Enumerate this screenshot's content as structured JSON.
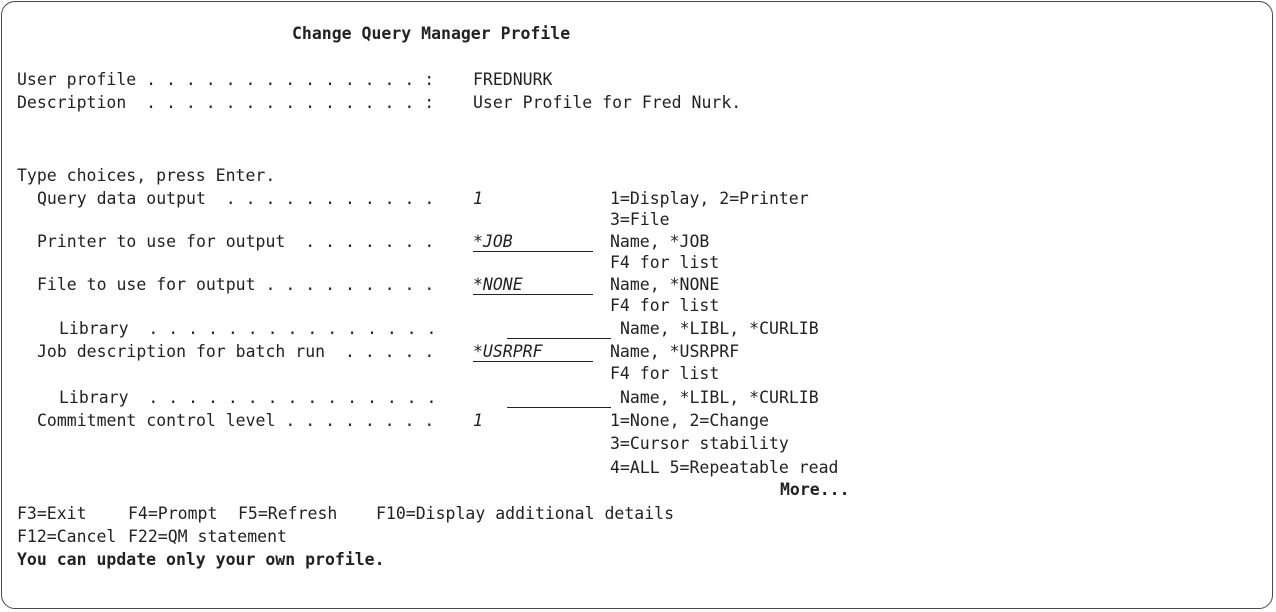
{
  "title": "Change Query Manager Profile",
  "header": {
    "user_profile_label": "User profile . . . . . . . . . . . . . . :",
    "user_profile_value": "FREDNURK",
    "description_label": "Description  . . . . . . . . . . . . . . :",
    "description_value": "User Profile for Fred Nurk."
  },
  "instruction": "Type choices, press Enter.",
  "fields": [
    {
      "label": "Query data output  . . . . . . . . . . .",
      "value": "1",
      "hint1": "1=Display, 2=Printer",
      "hint2": "3=File"
    },
    {
      "label": "Printer to use for output  . . . . . . .",
      "value": "*JOB",
      "hint1": "Name, *JOB",
      "hint2": "F4 for list"
    },
    {
      "label": "File to use for output . . . . . . . . .",
      "value": "*NONE",
      "hint1": "Name, *NONE",
      "hint2": "F4 for list"
    },
    {
      "label": "Library  . . . . . . . . . . . . . . .",
      "value": "",
      "hint1": "Name, *LIBL, *CURLIB"
    },
    {
      "label": "Job description for batch run  . . . . .",
      "value": "*USRPRF",
      "hint1": "Name, *USRPRF",
      "hint2": "F4 for list"
    },
    {
      "label": "Library  . . . . . . . . . . . . . . .",
      "value": "",
      "hint1": "Name, *LIBL, *CURLIB"
    },
    {
      "label": "Commitment control level . . . . . . . .",
      "value": "1",
      "hint1": "1=None, 2=Change",
      "hint2": "3=Cursor stability",
      "hint3": "4=ALL 5=Repeatable read"
    }
  ],
  "more": "More...",
  "fkeys": {
    "f3": "F3=Exit",
    "f4": "F4=Prompt",
    "f5": "F5=Refresh",
    "f10": "F10=Display additional details",
    "f12": "F12=Cancel",
    "f22": "F22=QM statement"
  },
  "message": "You can update only your own profile."
}
